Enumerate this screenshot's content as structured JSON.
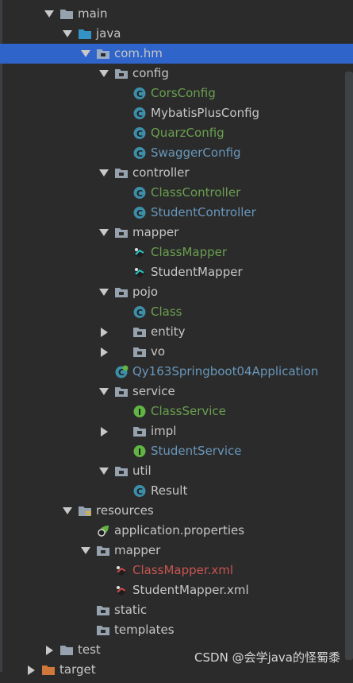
{
  "colors": {
    "background": "#2b2b2b",
    "selection": "#2f65ca",
    "default_text": "#c6c6c6",
    "modified_green": "#6a9f4f",
    "new_blue": "#6897bb",
    "error_red": "#c75450",
    "folder_gray": "#a9b7c6",
    "folder_blue": "#3592c4",
    "class_icon": "#3d8ea9",
    "interface_icon": "#62b543"
  },
  "tree": [
    {
      "label": "main",
      "depth": 0,
      "arrow": "down",
      "icon": "folder-icon",
      "color": "default"
    },
    {
      "label": "java",
      "depth": 1,
      "arrow": "down",
      "icon": "source-folder-icon",
      "color": "default"
    },
    {
      "label": "com.hm",
      "depth": 2,
      "arrow": "down",
      "icon": "package-icon",
      "color": "default",
      "selected": true
    },
    {
      "label": "config",
      "depth": 3,
      "arrow": "down",
      "icon": "package-icon",
      "color": "default"
    },
    {
      "label": "CorsConfig",
      "depth": 4,
      "arrow": "none",
      "icon": "class-icon",
      "color": "green"
    },
    {
      "label": "MybatisPlusConfig",
      "depth": 4,
      "arrow": "none",
      "icon": "class-icon",
      "color": "default"
    },
    {
      "label": "QuarzConfig",
      "depth": 4,
      "arrow": "none",
      "icon": "class-icon",
      "color": "green"
    },
    {
      "label": "SwaggerConfig",
      "depth": 4,
      "arrow": "none",
      "icon": "class-icon",
      "color": "blue"
    },
    {
      "label": "controller",
      "depth": 3,
      "arrow": "down",
      "icon": "package-icon",
      "color": "default"
    },
    {
      "label": "ClassController",
      "depth": 4,
      "arrow": "none",
      "icon": "class-icon",
      "color": "green"
    },
    {
      "label": "StudentController",
      "depth": 4,
      "arrow": "none",
      "icon": "class-icon",
      "color": "blue"
    },
    {
      "label": "mapper",
      "depth": 3,
      "arrow": "down",
      "icon": "package-icon",
      "color": "default"
    },
    {
      "label": "ClassMapper",
      "depth": 4,
      "arrow": "none",
      "icon": "mapper-icon",
      "color": "green"
    },
    {
      "label": "StudentMapper",
      "depth": 4,
      "arrow": "none",
      "icon": "mapper-icon",
      "color": "default"
    },
    {
      "label": "pojo",
      "depth": 3,
      "arrow": "down",
      "icon": "package-icon",
      "color": "default"
    },
    {
      "label": "Class",
      "depth": 4,
      "arrow": "none",
      "icon": "class-icon",
      "color": "green"
    },
    {
      "label": "entity",
      "depth": 4,
      "arrow": "right",
      "icon": "package-icon",
      "color": "default",
      "arrowAtDepth": 3
    },
    {
      "label": "vo",
      "depth": 4,
      "arrow": "right",
      "icon": "package-icon",
      "color": "default",
      "arrowAtDepth": 3
    },
    {
      "label": "Qy163Springboot04Application",
      "depth": 3,
      "arrow": "none",
      "icon": "spring-boot-class-icon",
      "color": "blue"
    },
    {
      "label": "service",
      "depth": 3,
      "arrow": "down",
      "icon": "package-icon",
      "color": "default"
    },
    {
      "label": "ClassService",
      "depth": 4,
      "arrow": "none",
      "icon": "interface-icon",
      "color": "green"
    },
    {
      "label": "impl",
      "depth": 4,
      "arrow": "right",
      "icon": "package-icon",
      "color": "default",
      "arrowAtDepth": 3
    },
    {
      "label": "StudentService",
      "depth": 4,
      "arrow": "none",
      "icon": "interface-icon",
      "color": "blue"
    },
    {
      "label": "util",
      "depth": 3,
      "arrow": "down",
      "icon": "package-icon",
      "color": "default"
    },
    {
      "label": "Result",
      "depth": 4,
      "arrow": "none",
      "icon": "class-icon",
      "color": "default"
    },
    {
      "label": "resources",
      "depth": 1,
      "arrow": "down",
      "icon": "resources-folder-icon",
      "color": "default"
    },
    {
      "label": "application.properties",
      "depth": 2,
      "arrow": "none",
      "icon": "properties-icon",
      "color": "default"
    },
    {
      "label": "mapper",
      "depth": 2,
      "arrow": "down",
      "icon": "package-icon",
      "color": "default"
    },
    {
      "label": "ClassMapper.xml",
      "depth": 3,
      "arrow": "none",
      "icon": "mybatis-xml-icon",
      "color": "red"
    },
    {
      "label": "StudentMapper.xml",
      "depth": 3,
      "arrow": "none",
      "icon": "mybatis-xml-icon",
      "color": "default"
    },
    {
      "label": "static",
      "depth": 2,
      "arrow": "none",
      "icon": "package-icon",
      "color": "default"
    },
    {
      "label": "templates",
      "depth": 2,
      "arrow": "none",
      "icon": "package-icon",
      "color": "default"
    },
    {
      "label": "test",
      "depth": 0,
      "arrow": "right",
      "icon": "folder-icon",
      "color": "default"
    },
    {
      "label": "target",
      "depth": -1,
      "arrow": "right",
      "icon": "excluded-folder-icon",
      "color": "default"
    }
  ],
  "watermark": "CSDN @会学java的怪蜀黍"
}
